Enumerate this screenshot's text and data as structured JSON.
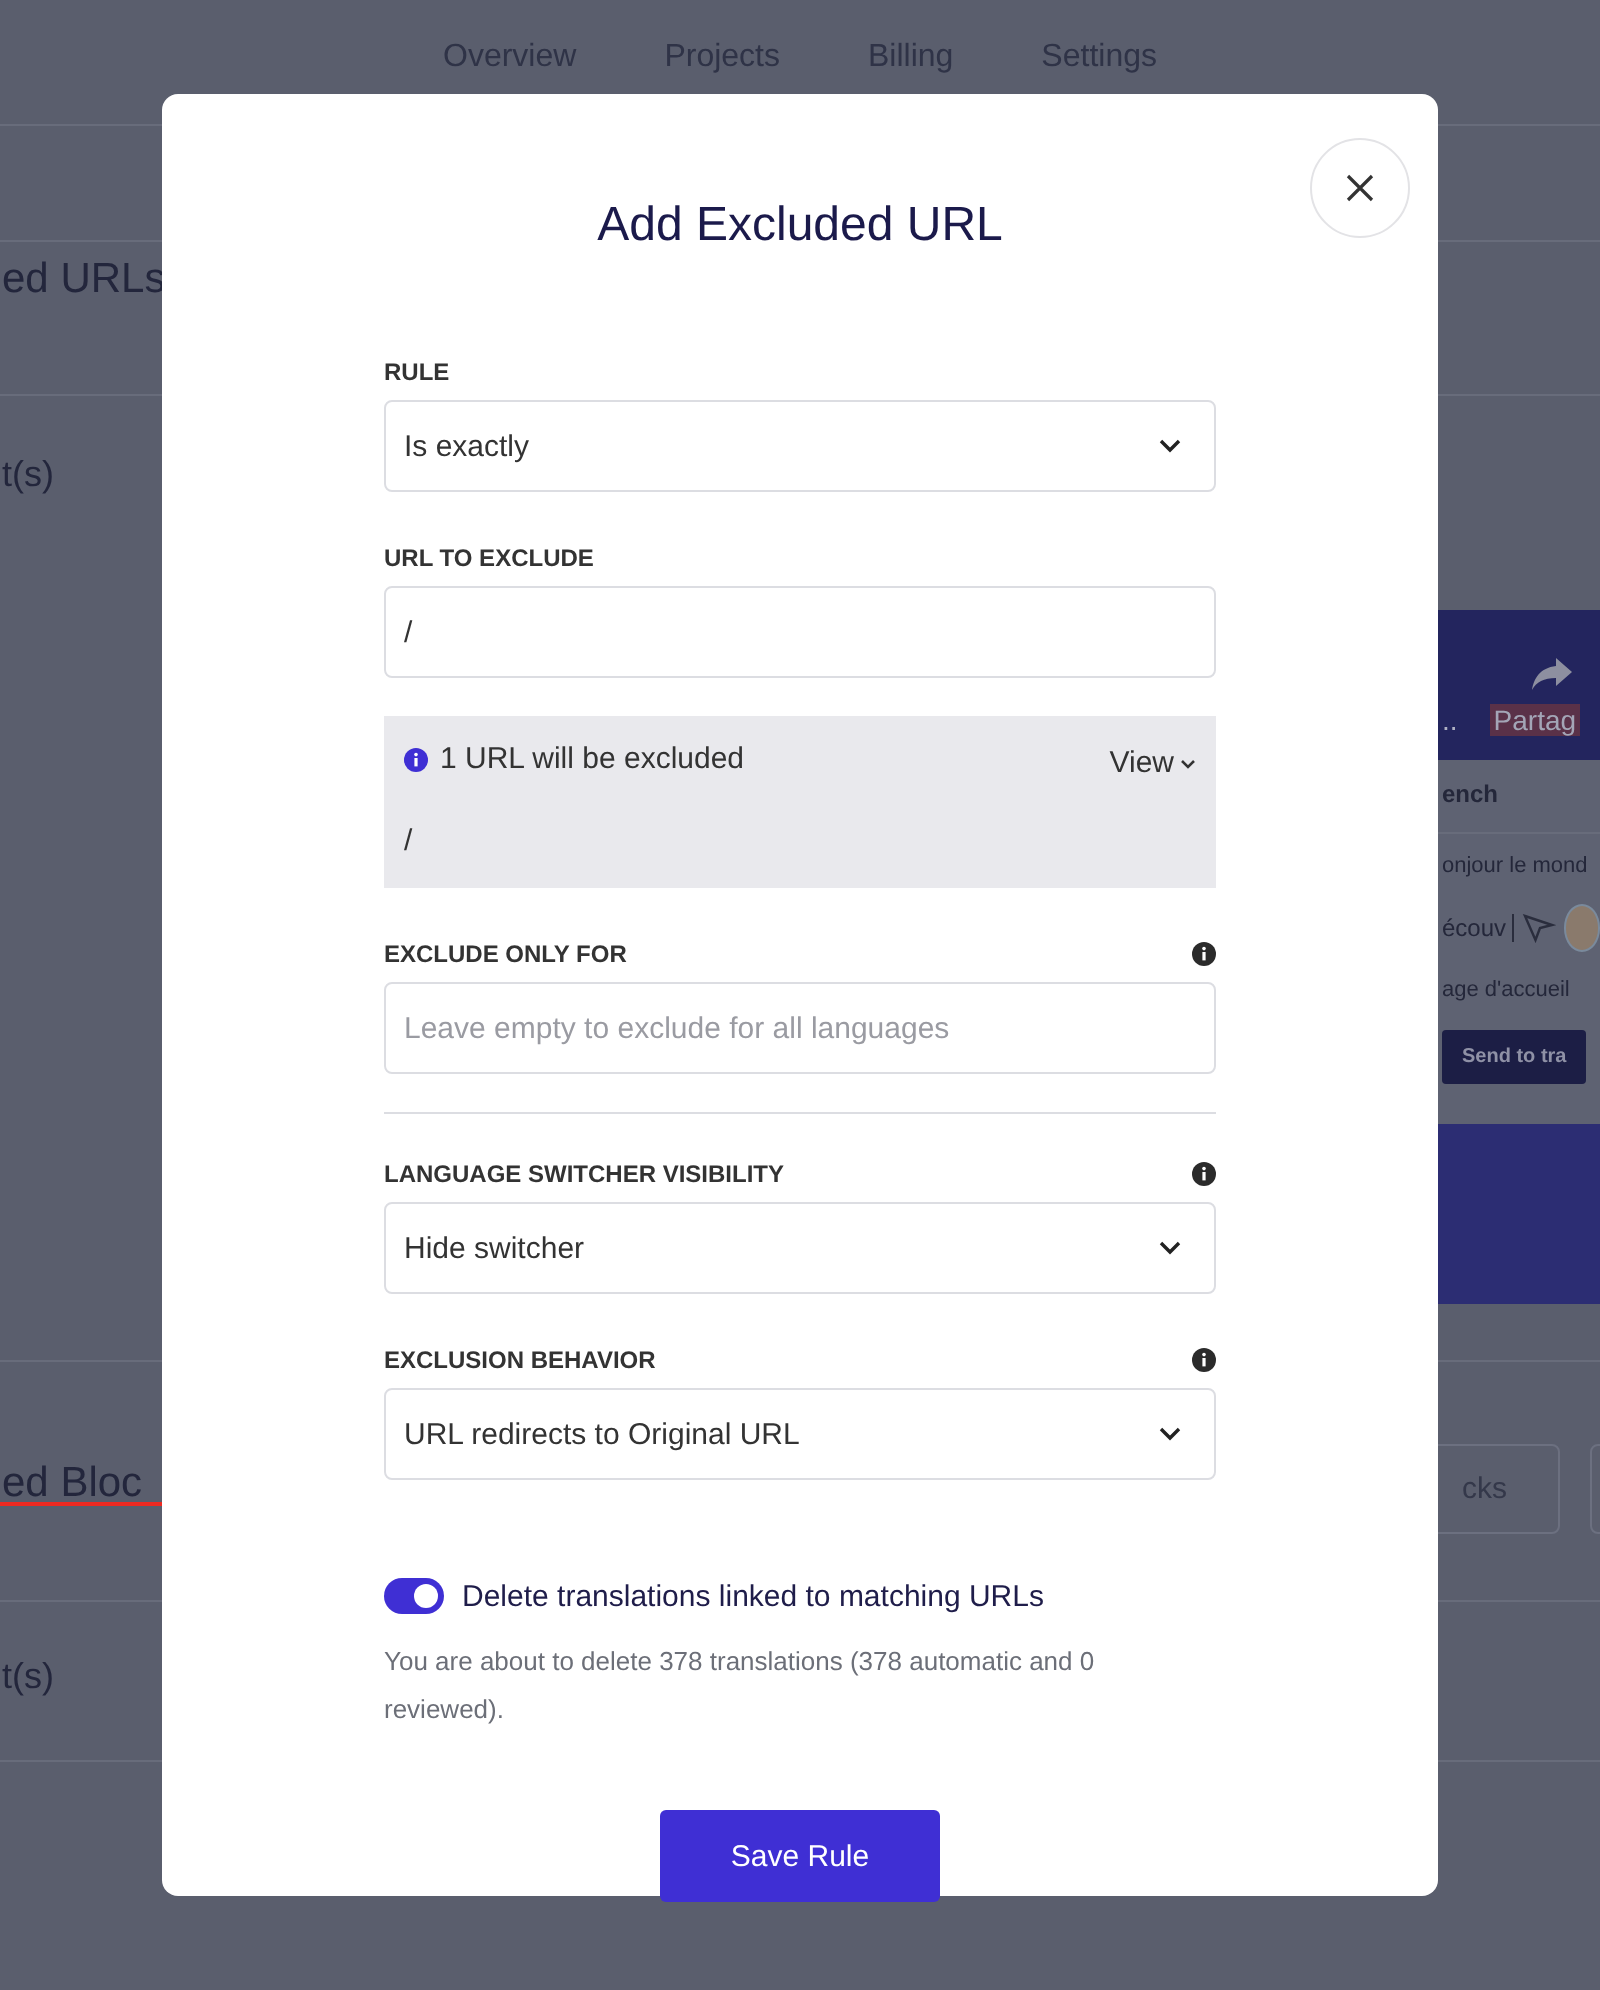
{
  "page": {
    "nav_tabs": [
      "Overview",
      "Projects",
      "Billing",
      "Settings"
    ],
    "section_titles": [
      "ed URLs",
      "ed Bloc"
    ],
    "row_texts": [
      "t(s)",
      "t(s)"
    ],
    "blocks_button": "cks",
    "preview": {
      "header_texts": [
        "..",
        "Partag"
      ],
      "language": "ench",
      "rows": [
        "onjour le mond",
        "écouv",
        "age d'accueil"
      ],
      "send_button": "Send to tra"
    }
  },
  "modal": {
    "title": "Add Excluded URL",
    "fields": [
      {
        "kind": "select",
        "label": "RULE",
        "value": "Is exactly",
        "info": false
      },
      {
        "kind": "input",
        "label": "URL TO EXCLUDE",
        "value": "/",
        "info": false
      },
      {
        "kind": "panel",
        "message": "1 URL will be excluded",
        "view_link": "View",
        "urls": [
          "/"
        ]
      },
      {
        "kind": "input",
        "label": "EXCLUDE ONLY FOR",
        "placeholder": "Leave empty to exclude for all languages",
        "info": true
      },
      {
        "kind": "divider"
      },
      {
        "kind": "select",
        "label": "LANGUAGE SWITCHER VISIBILITY",
        "value": "Hide switcher",
        "info": true
      },
      {
        "kind": "select",
        "label": "EXCLUSION BEHAVIOR",
        "value": "URL redirects to Original URL",
        "info": true
      }
    ],
    "delete_translations": {
      "on": true,
      "label": "Delete translations linked to matching URLs",
      "note": "You are about to delete 378 translations (378 automatic and 0 reviewed)."
    },
    "save_button": "Save Rule"
  }
}
